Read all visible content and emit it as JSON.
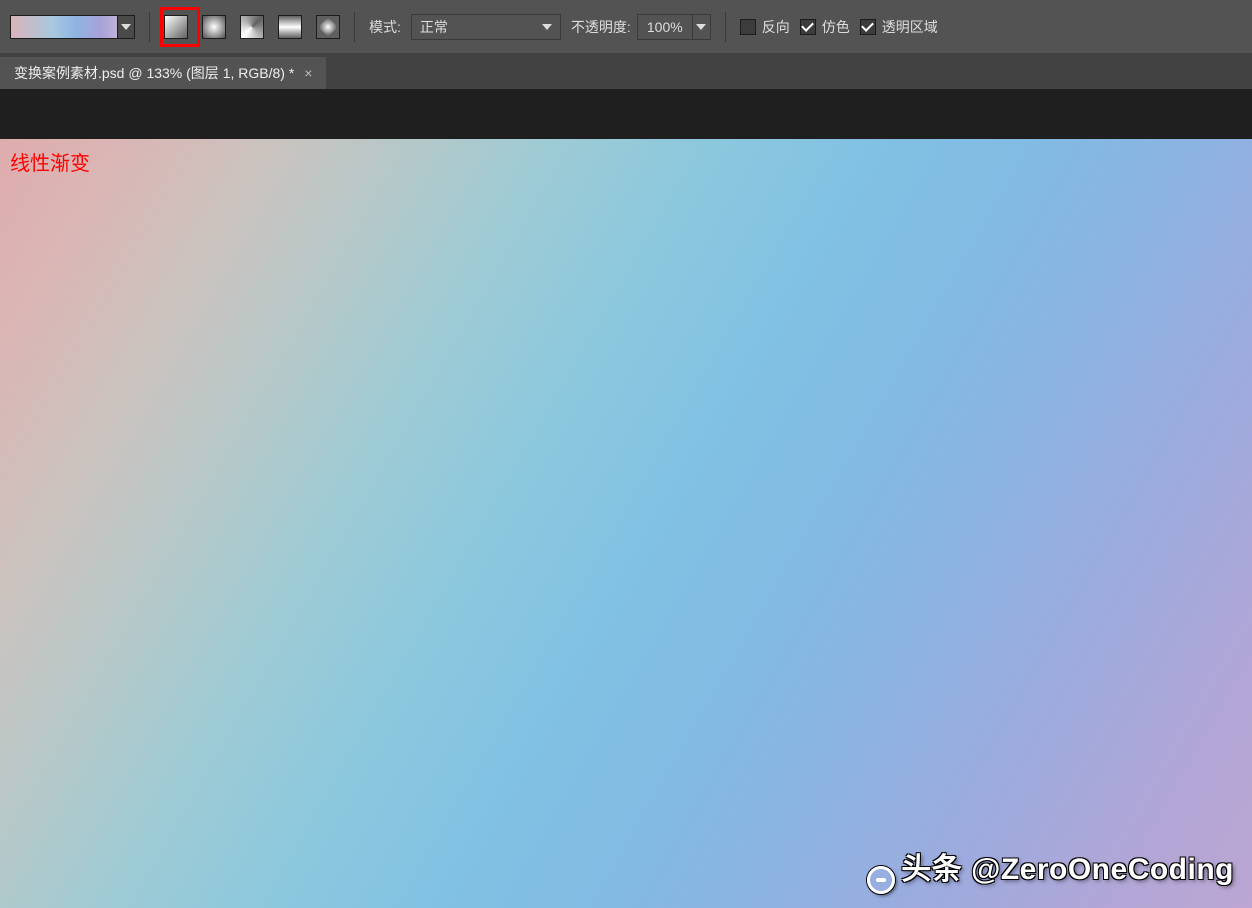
{
  "toolbar": {
    "mode_label": "模式:",
    "mode_value": "正常",
    "opacity_label": "不透明度:",
    "opacity_value": "100%",
    "reverse_label": "反向",
    "dither_label": "仿色",
    "transparency_label": "透明区域",
    "reverse_checked": false,
    "dither_checked": true,
    "transparency_checked": true,
    "gradient_types": [
      "linear",
      "radial",
      "angle",
      "reflected",
      "diamond"
    ],
    "highlighted_type": "linear"
  },
  "tab": {
    "title": "变换案例素材.psd @ 133% (图层 1, RGB/8) *"
  },
  "canvas": {
    "annotation": "线性渐变"
  },
  "watermark": {
    "text": "头条 @ZeroOneCoding"
  },
  "colors": {
    "accent_red": "#ff0000",
    "ui_bg": "#535353"
  }
}
